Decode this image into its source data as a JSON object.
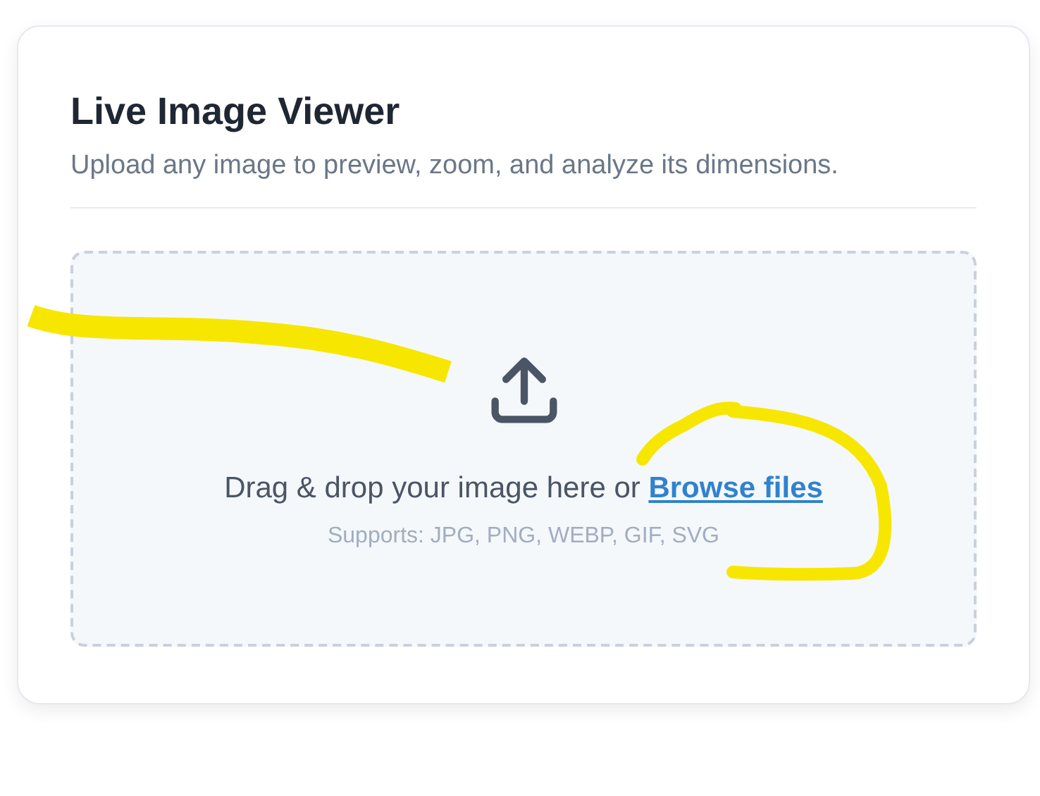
{
  "card": {
    "title": "Live Image Viewer",
    "subtitle": "Upload any image to preview, zoom, and analyze its dimensions."
  },
  "dropzone": {
    "prompt": "Drag & drop your image here or",
    "link": "Browse files",
    "formats": "Supports: JPG, PNG, WEBP, GIF, SVG"
  }
}
